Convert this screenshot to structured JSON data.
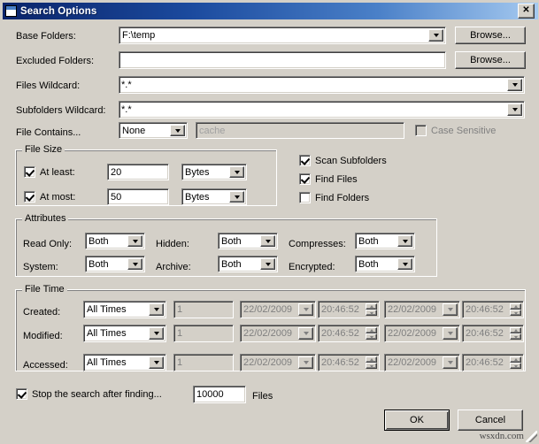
{
  "window": {
    "title": "Search Options",
    "icon": "window-icon",
    "close_label": "✕"
  },
  "fields": {
    "base_folders_label": "Base Folders:",
    "base_folders_value": "F:\\temp",
    "excluded_folders_label": "Excluded Folders:",
    "excluded_folders_value": "",
    "files_wildcard_label": "Files Wildcard:",
    "files_wildcard_value": "*.*",
    "subfolders_wildcard_label": "Subfolders Wildcard:",
    "subfolders_wildcard_value": "*.*",
    "file_contains_label": "File Contains...",
    "file_contains_value": "None",
    "file_contains_text_placeholder": "cache",
    "case_sensitive_label": "Case Sensitive",
    "browse1_label": "Browse...",
    "browse2_label": "Browse..."
  },
  "file_size": {
    "caption": "File Size",
    "at_least_label": "At least:",
    "at_least_value": "20",
    "at_least_unit": "Bytes",
    "at_most_label": "At most:",
    "at_most_value": "50",
    "at_most_unit": "Bytes"
  },
  "scan_options": {
    "scan_subfolders_label": "Scan Subfolders",
    "find_files_label": "Find Files",
    "find_folders_label": "Find Folders"
  },
  "attributes": {
    "caption": "Attributes",
    "rows": [
      {
        "label": "Read Only:",
        "value": "Both"
      },
      {
        "label": "System:",
        "value": "Both"
      },
      {
        "label": "Hidden:",
        "value": "Both"
      },
      {
        "label": "Archive:",
        "value": "Both"
      },
      {
        "label": "Compresses:",
        "value": "Both"
      },
      {
        "label": "Encrypted:",
        "value": "Both"
      }
    ]
  },
  "file_time": {
    "caption": "File Time",
    "rows": [
      {
        "label": "Created:",
        "mode": "All Times",
        "count": "1",
        "date1": "22/02/2009",
        "time1": "20:46:52",
        "date2": "22/02/2009",
        "time2": "20:46:52"
      },
      {
        "label": "Modified:",
        "mode": "All Times",
        "count": "1",
        "date1": "22/02/2009",
        "time1": "20:46:52",
        "date2": "22/02/2009",
        "time2": "20:46:52"
      },
      {
        "label": "Accessed:",
        "mode": "All Times",
        "count": "1",
        "date1": "22/02/2009",
        "time1": "20:46:52",
        "date2": "22/02/2009",
        "time2": "20:46:52"
      }
    ]
  },
  "footer": {
    "stop_label": "Stop the search after finding...",
    "stop_value": "10000",
    "files_label": "Files",
    "ok_label": "OK",
    "cancel_label": "Cancel",
    "watermark": "wsxdn.com"
  },
  "colors": {
    "dialog_face": "#d4d0c8",
    "title_start": "#0a246a",
    "title_end": "#a6caf0",
    "selection": "#0a246a",
    "disabled_text": "#808080"
  }
}
